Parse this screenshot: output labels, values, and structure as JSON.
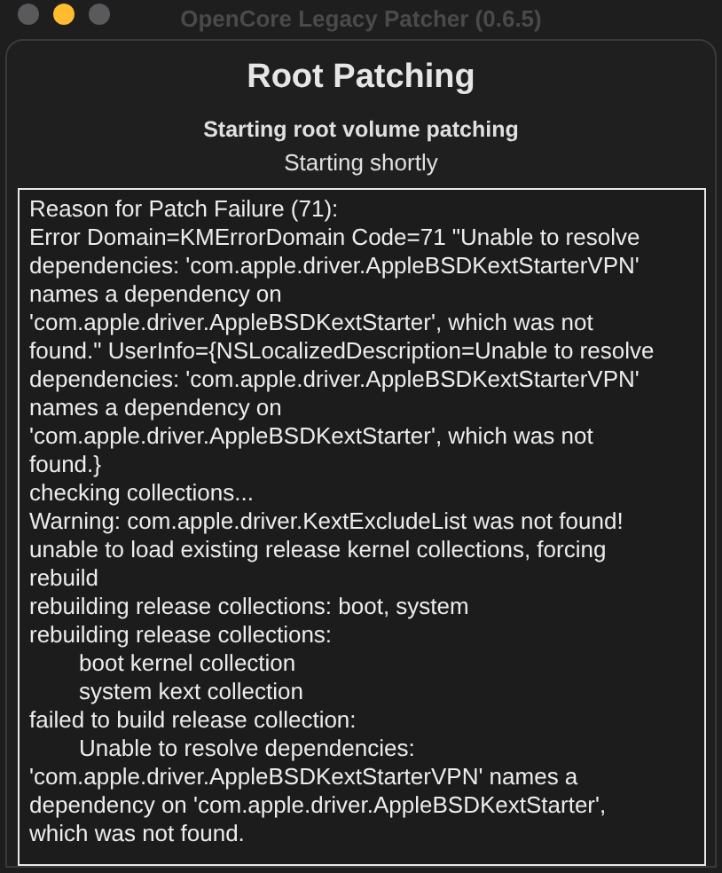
{
  "window": {
    "title": "OpenCore Legacy Patcher (0.6.5)"
  },
  "traffic_lights": [
    {
      "color": "#5a5a5c"
    },
    {
      "color": "#febc2e"
    },
    {
      "color": "#5a5a5c"
    }
  ],
  "heading": "Root Patching",
  "subtitle": "Starting root volume patching",
  "status": "Starting shortly",
  "log": [
    {
      "text": "Reason for Patch Failure (71):"
    },
    {
      "text": "Error Domain=KMErrorDomain Code=71 \"Unable to resolve"
    },
    {
      "text": "dependencies: 'com.apple.driver.AppleBSDKextStarterVPN'"
    },
    {
      "text": "names a dependency on"
    },
    {
      "text": "'com.apple.driver.AppleBSDKextStarter', which was not"
    },
    {
      "text": "found.\" UserInfo={NSLocalizedDescription=Unable to resolve"
    },
    {
      "text": "dependencies: 'com.apple.driver.AppleBSDKextStarterVPN'"
    },
    {
      "text": "names a dependency on"
    },
    {
      "text": "'com.apple.driver.AppleBSDKextStarter', which was not"
    },
    {
      "text": "found.}"
    },
    {
      "text": "checking collections..."
    },
    {
      "text": "Warning: com.apple.driver.KextExcludeList was not found!"
    },
    {
      "text": "unable to load existing release kernel collections, forcing"
    },
    {
      "text": "rebuild"
    },
    {
      "text": "rebuilding release collections: boot, system"
    },
    {
      "text": "rebuilding release collections:",
      "children": [
        {
          "text": "boot kernel collection"
        },
        {
          "text": "system kext collection"
        }
      ]
    },
    {
      "text": "failed to build release collection:",
      "children": [
        {
          "text": "Unable to resolve dependencies:"
        }
      ]
    },
    {
      "text": "'com.apple.driver.AppleBSDKextStarterVPN' names a"
    },
    {
      "text": "dependency on 'com.apple.driver.AppleBSDKextStarter',"
    },
    {
      "text": "which was not found."
    }
  ]
}
